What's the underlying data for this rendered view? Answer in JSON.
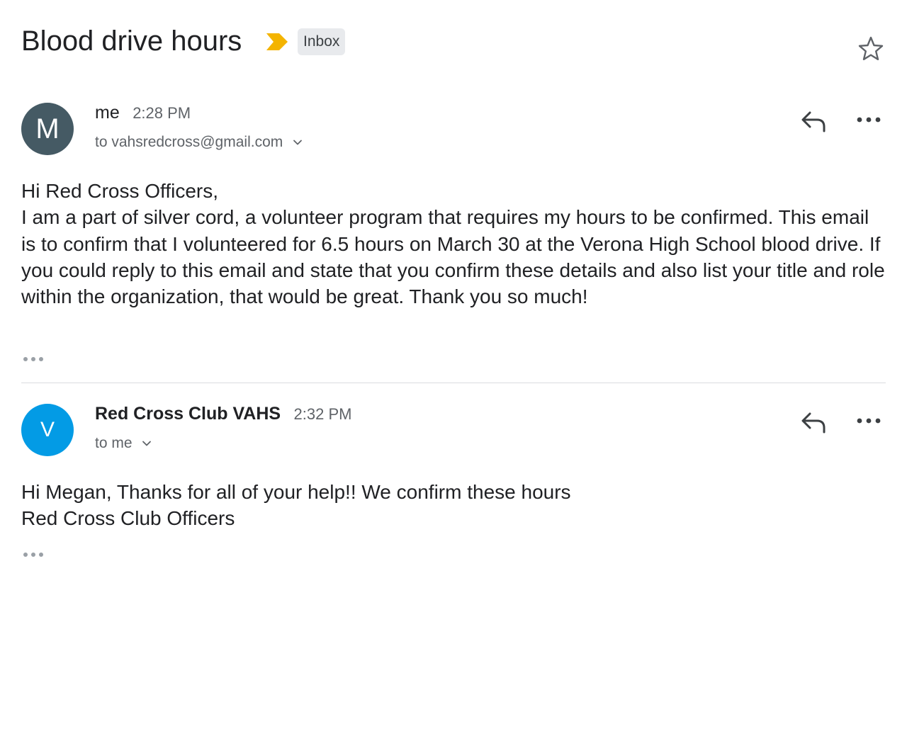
{
  "thread": {
    "subject": "Blood drive hours",
    "label": "Inbox",
    "important_color": "#f4b400"
  },
  "messages": [
    {
      "avatar_letter": "M",
      "avatar_color": "#455a64",
      "sender": "me",
      "time": "2:28 PM",
      "recipient": "to vahsredcross@gmail.com",
      "body": [
        "Hi Red Cross Officers,",
        "I am a part of silver cord, a volunteer program that requires my hours to be confirmed. This email is to confirm that I volunteered for 6.5 hours on March 30 at the Verona High School blood drive. If you could reply to this email and state that you confirm these details and also list your title and role within the organization, that would be great. Thank you so much!"
      ]
    },
    {
      "avatar_letter": "V",
      "avatar_color": "#039be5",
      "sender": "Red Cross Club VAHS",
      "time": "2:32 PM",
      "recipient": "to me",
      "body": [
        "Hi Megan, Thanks for all of your help!! We confirm these hours",
        "Red Cross Club Officers"
      ]
    }
  ],
  "icons": {
    "important": "importance-marker-icon",
    "star": "star-icon",
    "reply": "reply-icon",
    "more": "more-horizontal-icon",
    "chevron": "chevron-down-icon",
    "trimmed": "ellipsis-icon"
  }
}
